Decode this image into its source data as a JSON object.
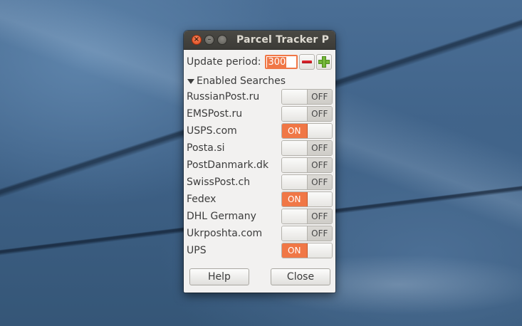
{
  "window": {
    "title": "Parcel Tracker P",
    "close_glyph": "×",
    "min_glyph": "–",
    "max_glyph": "□"
  },
  "update_period": {
    "label": "Update period:",
    "value": "300",
    "decrement_icon": "minus-icon",
    "increment_icon": "plus-icon"
  },
  "enabled_searches": {
    "header": "Enabled Searches",
    "items": [
      {
        "label": "RussianPost.ru",
        "state": "OFF"
      },
      {
        "label": "EMSPost.ru",
        "state": "OFF"
      },
      {
        "label": "USPS.com",
        "state": "ON"
      },
      {
        "label": "Posta.si",
        "state": "OFF"
      },
      {
        "label": "PostDanmark.dk",
        "state": "OFF"
      },
      {
        "label": "SwissPost.ch",
        "state": "OFF"
      },
      {
        "label": "Fedex",
        "state": "ON"
      },
      {
        "label": "DHL Germany",
        "state": "OFF"
      },
      {
        "label": "Ukrposhta.com",
        "state": "OFF"
      },
      {
        "label": "UPS",
        "state": "ON"
      }
    ]
  },
  "buttons": {
    "help": "Help",
    "close": "Close"
  },
  "colors": {
    "accent": "#f07746",
    "titlebar": "#3c3b37",
    "window_bg": "#f2f1f0"
  }
}
